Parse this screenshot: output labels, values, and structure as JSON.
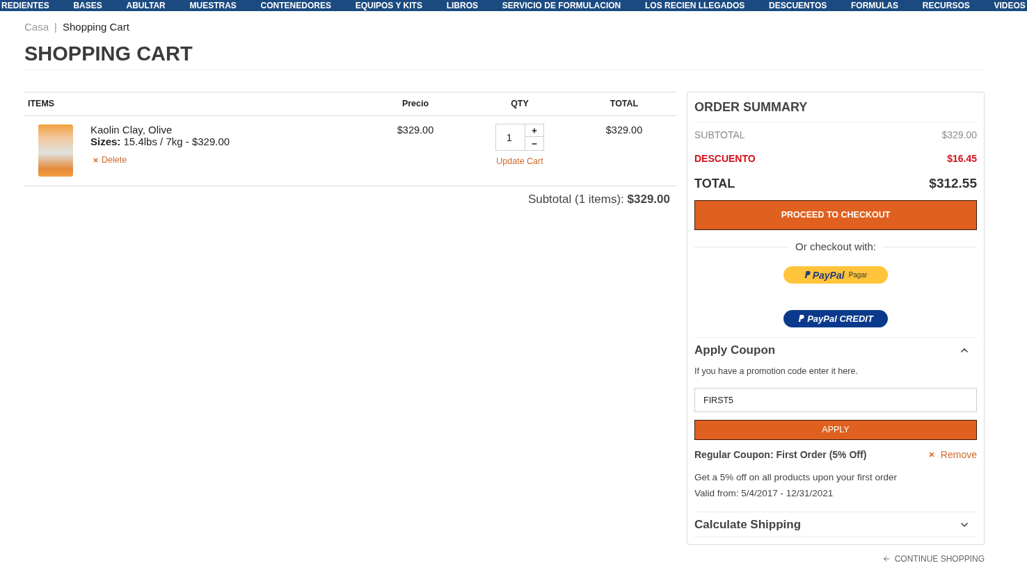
{
  "nav": {
    "items": [
      "REDIENTES",
      "BASES",
      "ABULTAR",
      "MUESTRAS",
      "CONTENEDORES",
      "EQUIPOS Y KITS",
      "LIBROS",
      "SERVICIO DE FORMULACION",
      "LOS RECIEN LLEGADOS",
      "DESCUENTOS",
      "FORMULAS",
      "RECURSOS",
      "VIDEOS"
    ]
  },
  "breadcrumb": {
    "separator": "|",
    "items": [
      {
        "label": "Casa",
        "current": false
      },
      {
        "label": "Shopping Cart",
        "current": true
      }
    ]
  },
  "page_title": "SHOPPING CART",
  "cart": {
    "columns": [
      "ITEMS",
      "Precio",
      "QTY",
      "TOTAL"
    ],
    "rows": [
      {
        "name": "Kaolin Clay, Olive",
        "sizes": "**Sizes:** 15.4lbs / 7kg - $329.00",
        "delete": "Delete",
        "price": "$329.00",
        "qty": "1",
        "update": "Update Cart",
        "total": "$329.00"
      }
    ],
    "subtotal": "Subtotal (1 items): **$329.00**"
  },
  "order_summary": {
    "title": "ORDER SUMMARY",
    "lines": [
      {
        "kind": "subtotal",
        "label": "SUBTOTAL",
        "value": "$329.00"
      },
      {
        "kind": "discount",
        "label": "DESCUENTO",
        "value": "$16.45"
      },
      {
        "kind": "total",
        "label": "TOTAL",
        "value": "$312.55"
      }
    ],
    "checkout_button": "PROCEED TO CHECKOUT",
    "alt_checkout": "Or checkout with:",
    "wallet_buttons": [
      {
        "kind": "paypal",
        "brand": "PayPal",
        "label": "Pagar"
      },
      {
        "kind": "credit",
        "brand": "PayPal",
        "label": "CREDIT"
      }
    ],
    "coupon": {
      "title": "Apply Coupon",
      "expanded": true,
      "hint": "If you have a promotion code enter it here.",
      "code": "FIRST5",
      "apply_button": "APPLY",
      "applied": {
        "name": "Regular Coupon: First Order (5% Off)",
        "remove": "Remove",
        "description": "Get a 5% off on all products upon your first order",
        "validity": "Valid from: 5/4/2017 - 12/31/2021"
      }
    },
    "shipping": {
      "title": "Calculate Shipping",
      "expanded": false
    }
  },
  "continue_shopping": "CONTINUE SHOPPING"
}
